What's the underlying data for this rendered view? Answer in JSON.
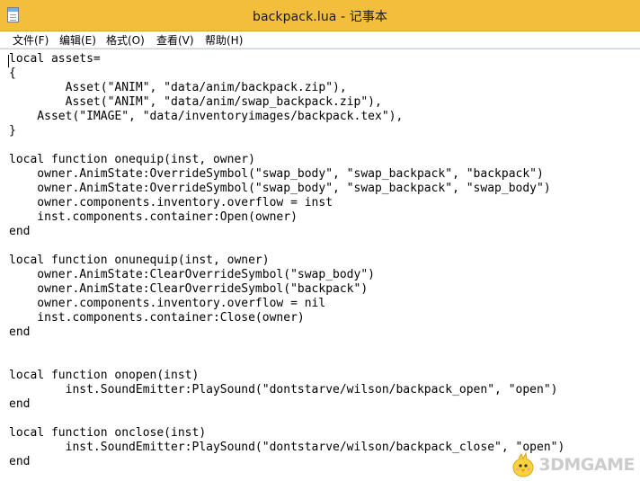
{
  "window": {
    "title": "backpack.lua - 记事本"
  },
  "menu": [
    "文件(F)",
    "编辑(E)",
    "格式(O)",
    "查看(V)",
    "帮助(H)"
  ],
  "editor": {
    "lines": [
      "local assets=",
      "{",
      "        Asset(\"ANIM\", \"data/anim/backpack.zip\"),",
      "        Asset(\"ANIM\", \"data/anim/swap_backpack.zip\"),",
      "    Asset(\"IMAGE\", \"data/inventoryimages/backpack.tex\"),",
      "}",
      "",
      "local function onequip(inst, owner)",
      "    owner.AnimState:OverrideSymbol(\"swap_body\", \"swap_backpack\", \"backpack\")",
      "    owner.AnimState:OverrideSymbol(\"swap_body\", \"swap_backpack\", \"swap_body\")",
      "    owner.components.inventory.overflow = inst",
      "    inst.components.container:Open(owner)",
      "end",
      "",
      "local function onunequip(inst, owner)",
      "    owner.AnimState:ClearOverrideSymbol(\"swap_body\")",
      "    owner.AnimState:ClearOverrideSymbol(\"backpack\")",
      "    owner.components.inventory.overflow = nil",
      "    inst.components.container:Close(owner)",
      "end",
      "",
      "",
      "local function onopen(inst)",
      "        inst.SoundEmitter:PlaySound(\"dontstarve/wilson/backpack_open\", \"open\")",
      "end",
      "",
      "local function onclose(inst)",
      "        inst.SoundEmitter:PlaySound(\"dontstarve/wilson/backpack_close\", \"open\")",
      "end"
    ]
  },
  "watermark": {
    "text": "3DMGAME"
  },
  "colors": {
    "titlebar": "#f2be3c",
    "watermark": "#cccccc"
  }
}
